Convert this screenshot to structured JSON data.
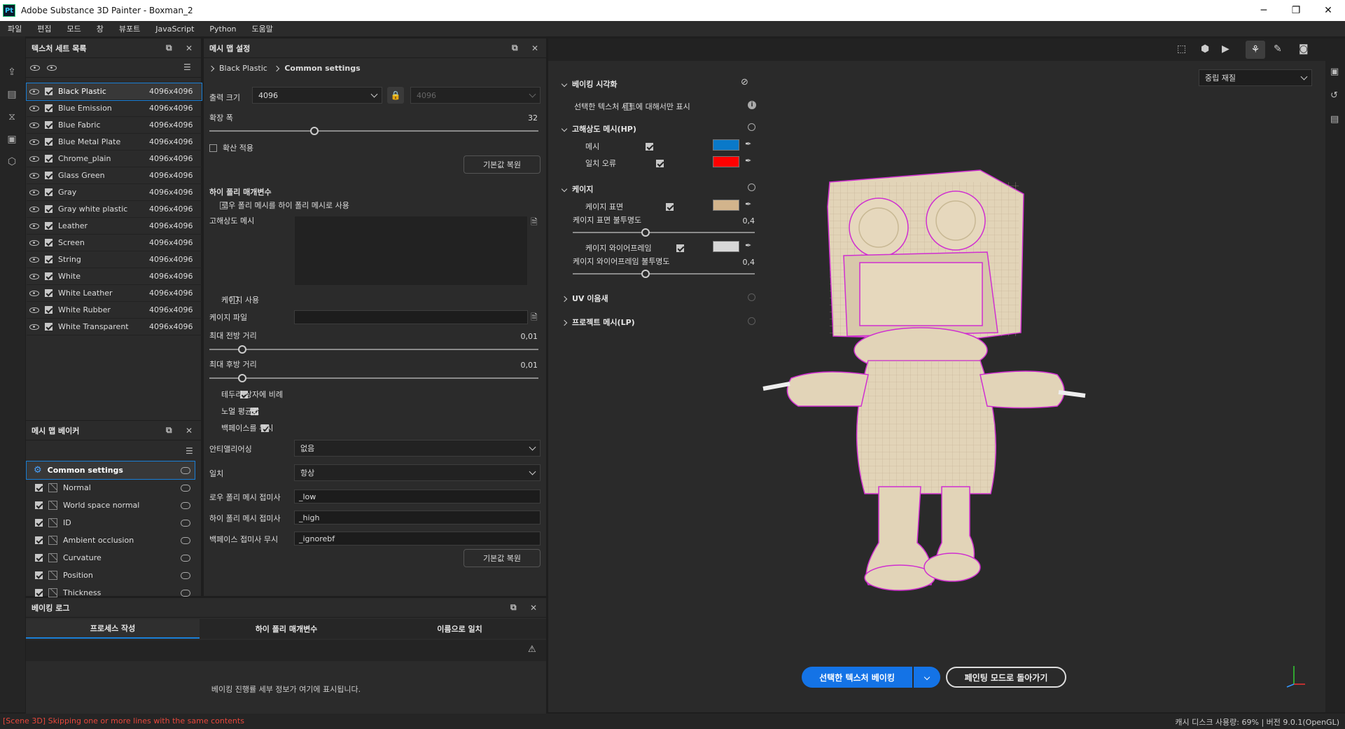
{
  "window": {
    "logo": "Pt",
    "title": "Adobe Substance 3D Painter - Boxman_2",
    "minimize": "─",
    "maximize": "❐",
    "close": "✕"
  },
  "menu": [
    "파일",
    "편집",
    "모드",
    "창",
    "뷰포트",
    "JavaScript",
    "Python",
    "도움말"
  ],
  "texture_set_list": {
    "title": "텍스처 세트 목록",
    "items": [
      {
        "name": "Black Plastic",
        "size": "4096x4096",
        "selected": true
      },
      {
        "name": "Blue Emission",
        "size": "4096x4096"
      },
      {
        "name": "Blue Fabric",
        "size": "4096x4096"
      },
      {
        "name": "Blue Metal Plate",
        "size": "4096x4096"
      },
      {
        "name": "Chrome_plain",
        "size": "4096x4096"
      },
      {
        "name": "Glass Green",
        "size": "4096x4096"
      },
      {
        "name": "Gray",
        "size": "4096x4096"
      },
      {
        "name": "Gray white plastic",
        "size": "4096x4096"
      },
      {
        "name": "Leather",
        "size": "4096x4096"
      },
      {
        "name": "Screen",
        "size": "4096x4096"
      },
      {
        "name": "String",
        "size": "4096x4096"
      },
      {
        "name": "White",
        "size": "4096x4096"
      },
      {
        "name": "White Leather",
        "size": "4096x4096"
      },
      {
        "name": "White Rubber",
        "size": "4096x4096"
      },
      {
        "name": "White Transparent",
        "size": "4096x4096"
      }
    ]
  },
  "bakers": {
    "title": "메시 맵 베이커",
    "items": [
      {
        "name": "Common settings",
        "common": true
      },
      {
        "name": "Normal"
      },
      {
        "name": "World space normal"
      },
      {
        "name": "ID"
      },
      {
        "name": "Ambient occlusion"
      },
      {
        "name": "Curvature"
      },
      {
        "name": "Position"
      },
      {
        "name": "Thickness"
      }
    ]
  },
  "mesh_map_settings": {
    "title": "메시 맵 설정",
    "breadcrumb": [
      "Black Plastic",
      "Common settings"
    ],
    "output_size_label": "출력 크기",
    "output_size": "4096",
    "output_size_locked": "4096",
    "dilation_label": "확장 폭",
    "dilation_value": "32",
    "dilation_fraction": 0.32,
    "apply_diffusion": "확산 적용",
    "reset": "기본값 복원",
    "high_poly_header": "하이 폴리 매개변수",
    "use_low_as_high": "로우 폴리 메시를 하이 폴리 메시로 사용",
    "high_res_mesh_label": "고해상도 메시",
    "use_cage": "케이지 사용",
    "cage_file": "케이지 파일",
    "max_frontal": "최대 전방 거리",
    "max_frontal_value": "0,01",
    "max_frontal_fraction": 0.1,
    "max_rear": "최대 후방 거리",
    "max_rear_value": "0,01",
    "max_rear_fraction": 0.1,
    "relative_bbox": "테두리 상자에 비례",
    "average_normals": "노멀 평균값",
    "ignore_backface": "백페이스를 무시",
    "antialiasing_label": "안티앨리어싱",
    "antialiasing": "없음",
    "match_label": "일치",
    "match": "항상",
    "low_suffix_label": "로우 폴리 메시 접미사",
    "low_suffix": "_low",
    "high_suffix_label": "하이 폴리 메시 접미사",
    "high_suffix": "_high",
    "ignore_suffix_label": "백페이스 접미사 무시",
    "ignore_suffix": "_ignorebf",
    "reset2": "기본값 복원"
  },
  "bake_vis": {
    "header": "베이킹 시각화",
    "only_selected": "선택한 텍스처 세트에 대해서만 표시",
    "hp_header": "고해상도 메시(HP)",
    "mesh": "메시",
    "mesh_color": "#0a79c9",
    "match_error": "일치 오류",
    "match_error_color": "#ff0000",
    "cage_header": "케이지",
    "cage_surface": "케이지 표면",
    "cage_surface_color": "#d2b48c",
    "cage_surface_opacity_label": "케이지 표면 불투명도",
    "cage_surface_opacity": "0,4",
    "cage_wire": "케이지 와이어프레임",
    "cage_wire_color": "#d8d8d8",
    "cage_wire_opacity_label": "케이지 와이어프레임 불투명도",
    "cage_wire_opacity": "0,4",
    "uv_header": "UV 이음새",
    "lp_header": "프로젝트 메시(LP)"
  },
  "viewport": {
    "material_mode": "중립 재질",
    "bake_button": "선택한 텍스처 베이킹",
    "back_button": "페인팅 모드로 돌아가기"
  },
  "bake_log": {
    "title": "베이킹 로그",
    "tabs": [
      "프로세스 작성",
      "하이 폴리 매개변수",
      "이름으로 일치"
    ],
    "message": "베이킹 진행률 세부 정보가 여기에 표시됩니다."
  },
  "status": {
    "left": "[Scene 3D] Skipping one or more lines with the same contents",
    "right": "캐시 디스크 사용량:   69% | 버전 9.0.1(OpenGL)"
  }
}
